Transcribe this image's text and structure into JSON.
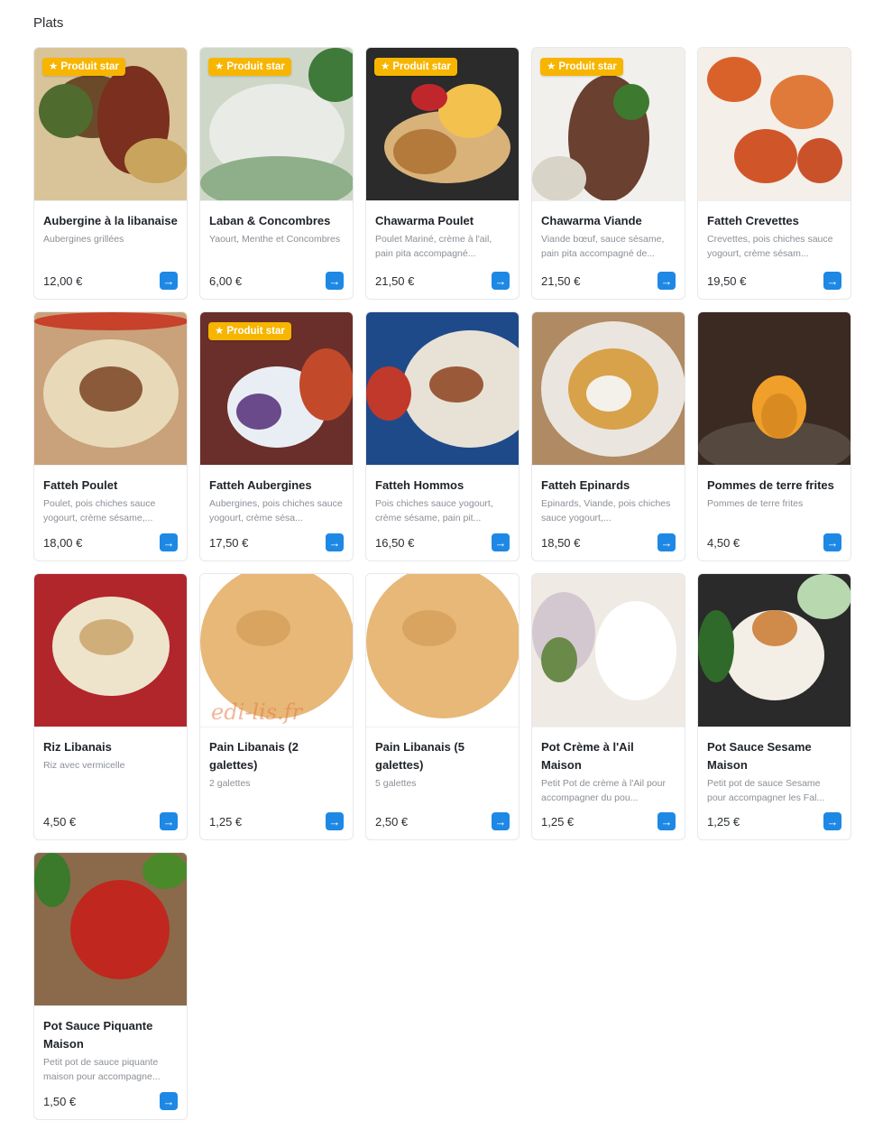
{
  "section": {
    "title": "Plats"
  },
  "badge_label": "Produit star",
  "colors": {
    "badge": "#f7b500",
    "action": "#1e88e5",
    "price": "#2b2f33",
    "desc": "#8a8f96"
  },
  "icons": {
    "badge": "star-icon",
    "action": "arrow-right-icon"
  },
  "products": [
    {
      "name": "Aubergine à la libanaise",
      "desc": "Aubergines grillées",
      "price": "12,00 €",
      "star": true,
      "img": {
        "bg": "#d9c49a",
        "blobs": [
          [
            "#6b4a2a",
            20,
            30,
            90,
            70
          ],
          [
            "#4f6b2e",
            5,
            40,
            60,
            60
          ],
          [
            "#7a2f1f",
            70,
            20,
            80,
            120
          ],
          [
            "#c9a45c",
            100,
            100,
            70,
            50
          ]
        ]
      }
    },
    {
      "name": "Laban & Concombres",
      "desc": "Yaourt, Menthe et Concombres",
      "price": "6,00 €",
      "star": true,
      "img": {
        "bg": "#cfd8c8",
        "blobs": [
          [
            "#e9ece6",
            10,
            40,
            150,
            110
          ],
          [
            "#8fae8a",
            0,
            120,
            171,
            60
          ],
          [
            "#3f7a3a",
            120,
            0,
            60,
            60
          ]
        ]
      }
    },
    {
      "name": "Chawarma Poulet",
      "desc": "Poulet Mariné, crème à l'ail, pain pita accompagné...",
      "price": "21,50 €",
      "star": true,
      "img": {
        "bg": "#2b2b2b",
        "blobs": [
          [
            "#d9b27a",
            20,
            70,
            140,
            80
          ],
          [
            "#f2c14e",
            80,
            40,
            70,
            60
          ],
          [
            "#c0272d",
            50,
            40,
            40,
            30
          ],
          [
            "#b37a3c",
            30,
            90,
            70,
            50
          ]
        ]
      }
    },
    {
      "name": "Chawarma Viande",
      "desc": "Viande bœuf, sauce sésame, pain pita accompagné de...",
      "price": "21,50 €",
      "star": true,
      "img": {
        "bg": "#f2f0ec",
        "blobs": [
          [
            "#6a4030",
            40,
            30,
            90,
            140
          ],
          [
            "#3d7a2f",
            90,
            40,
            40,
            40
          ],
          [
            "#d9d4c8",
            0,
            120,
            60,
            50
          ]
        ]
      }
    },
    {
      "name": "Fatteh Crevettes",
      "desc": "Crevettes, pois chiches sauce yogourt, crème sésam...",
      "price": "19,50 €",
      "star": false,
      "img": {
        "bg": "#f4efe9",
        "blobs": [
          [
            "#d9622b",
            10,
            10,
            60,
            50
          ],
          [
            "#e07a3a",
            80,
            30,
            70,
            60
          ],
          [
            "#d0562a",
            40,
            90,
            70,
            60
          ],
          [
            "#c9522a",
            110,
            100,
            50,
            50
          ]
        ]
      }
    },
    {
      "name": "Fatteh Poulet",
      "desc": "Poulet, pois chiches sauce yogourt, crème sésame,...",
      "price": "18,00 €",
      "star": false,
      "img": {
        "bg": "#c9a17a",
        "blobs": [
          [
            "#e8d9b8",
            10,
            30,
            150,
            120
          ],
          [
            "#8a5a3a",
            50,
            60,
            70,
            50
          ],
          [
            "#c7412b",
            0,
            0,
            171,
            20
          ]
        ]
      }
    },
    {
      "name": "Fatteh Aubergines",
      "desc": "Aubergines, pois chiches sauce yogourt, crème sésa...",
      "price": "17,50 €",
      "star": true,
      "img": {
        "bg": "#6a2f2a",
        "blobs": [
          [
            "#e9eef4",
            30,
            60,
            110,
            90
          ],
          [
            "#6a4a8a",
            40,
            90,
            50,
            40
          ],
          [
            "#c24a2a",
            110,
            40,
            60,
            80
          ]
        ]
      }
    },
    {
      "name": "Fatteh Hommos",
      "desc": "Pois chiches sauce yogourt, crème sésame, pain pit...",
      "price": "16,50 €",
      "star": false,
      "img": {
        "bg": "#1f4a8a",
        "blobs": [
          [
            "#e8e2d6",
            40,
            20,
            150,
            130
          ],
          [
            "#9a5a3a",
            70,
            60,
            60,
            40
          ],
          [
            "#c0392b",
            0,
            60,
            50,
            60
          ]
        ]
      }
    },
    {
      "name": "Fatteh Epinards",
      "desc": "Epinards, Viande, pois chiches sauce yogourt,...",
      "price": "18,50 €",
      "star": false,
      "img": {
        "bg": "#b08a62",
        "blobs": [
          [
            "#eae6df",
            10,
            10,
            160,
            150
          ],
          [
            "#d8a24a",
            40,
            40,
            100,
            90
          ],
          [
            "#f4f1ea",
            60,
            70,
            50,
            40
          ]
        ]
      }
    },
    {
      "name": "Pommes de terre frites",
      "desc": "Pommes de terre frites",
      "price": "4,50 €",
      "star": false,
      "img": {
        "bg": "#3a2a22",
        "blobs": [
          [
            "#55483f",
            0,
            120,
            171,
            60
          ],
          [
            "#f0a02a",
            60,
            70,
            60,
            70
          ],
          [
            "#d98a20",
            70,
            90,
            40,
            50
          ]
        ]
      }
    },
    {
      "name": "Riz Libanais",
      "desc": "Riz avec vermicelle",
      "price": "4,50 €",
      "star": false,
      "img": {
        "bg": "#b1262b",
        "blobs": [
          [
            "#eee4cc",
            20,
            25,
            130,
            110
          ],
          [
            "#cfae7a",
            50,
            50,
            60,
            40
          ]
        ]
      }
    },
    {
      "name": "Pain Libanais (2 galettes)",
      "desc": "2 galettes",
      "price": "1,25 €",
      "star": false,
      "watermark": "edi-lis.fr",
      "img": {
        "bg": "#ffffff",
        "blobs": [
          [
            "#e7b878",
            0,
            -10,
            171,
            170
          ],
          [
            "#d9a460",
            40,
            40,
            60,
            40
          ]
        ]
      }
    },
    {
      "name": "Pain Libanais (5 galettes)",
      "desc": "5 galettes",
      "price": "2,50 €",
      "star": false,
      "img": {
        "bg": "#ffffff",
        "blobs": [
          [
            "#e7b878",
            0,
            -10,
            171,
            170
          ],
          [
            "#d9a460",
            40,
            40,
            60,
            40
          ]
        ]
      }
    },
    {
      "name": "Pot Crème à l'Ail Maison",
      "desc": "Petit Pot de crème à l'Ail pour accompagner du pou...",
      "price": "1,25 €",
      "star": false,
      "img": {
        "bg": "#efeae4",
        "blobs": [
          [
            "#ffffff",
            70,
            30,
            90,
            110
          ],
          [
            "#d4c8d0",
            0,
            20,
            70,
            90
          ],
          [
            "#6a8a4a",
            10,
            70,
            40,
            50
          ]
        ]
      }
    },
    {
      "name": "Pot Sauce Sesame Maison",
      "desc": "Petit pot de sauce Sesame pour accompagner les Fal...",
      "price": "1,25 €",
      "star": false,
      "img": {
        "bg": "#2a2a2a",
        "blobs": [
          [
            "#f3efe6",
            30,
            40,
            110,
            100
          ],
          [
            "#2f6a2a",
            0,
            40,
            40,
            80
          ],
          [
            "#b8d8b0",
            110,
            0,
            60,
            50
          ],
          [
            "#d08a4a",
            60,
            40,
            50,
            40
          ]
        ]
      }
    },
    {
      "name": "Pot Sauce Piquante Maison",
      "desc": "Petit pot de sauce piquante maison pour accompagne...",
      "price": "1,50 €",
      "star": false,
      "img": {
        "bg": "#8a6a4a",
        "blobs": [
          [
            "#c0271f",
            40,
            30,
            110,
            110
          ],
          [
            "#3a7a2a",
            0,
            0,
            40,
            60
          ],
          [
            "#4a8a2a",
            120,
            0,
            50,
            40
          ]
        ]
      }
    }
  ]
}
